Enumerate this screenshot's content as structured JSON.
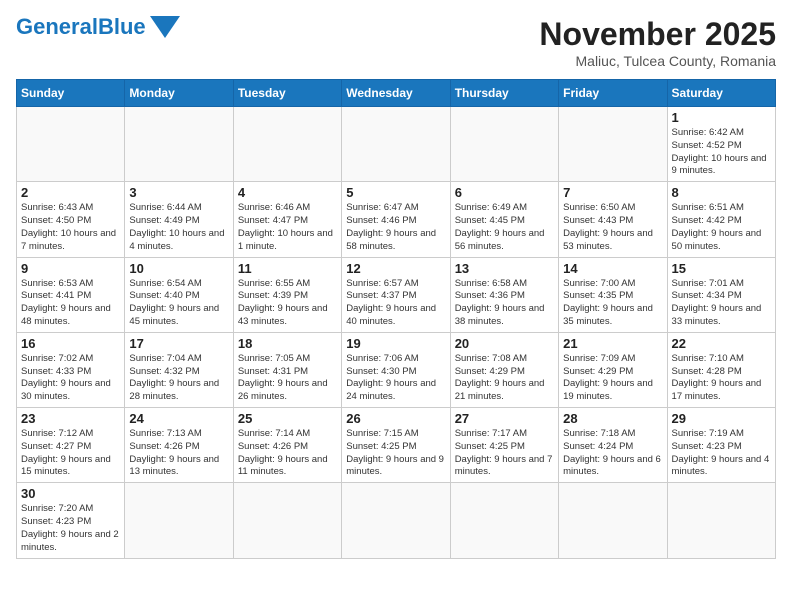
{
  "header": {
    "logo_general": "General",
    "logo_blue": "Blue",
    "month_title": "November 2025",
    "subtitle": "Maliuc, Tulcea County, Romania"
  },
  "days_of_week": [
    "Sunday",
    "Monday",
    "Tuesday",
    "Wednesday",
    "Thursday",
    "Friday",
    "Saturday"
  ],
  "weeks": [
    [
      {
        "day": "",
        "info": ""
      },
      {
        "day": "",
        "info": ""
      },
      {
        "day": "",
        "info": ""
      },
      {
        "day": "",
        "info": ""
      },
      {
        "day": "",
        "info": ""
      },
      {
        "day": "",
        "info": ""
      },
      {
        "day": "1",
        "info": "Sunrise: 6:42 AM\nSunset: 4:52 PM\nDaylight: 10 hours and 9 minutes."
      }
    ],
    [
      {
        "day": "2",
        "info": "Sunrise: 6:43 AM\nSunset: 4:50 PM\nDaylight: 10 hours and 7 minutes."
      },
      {
        "day": "3",
        "info": "Sunrise: 6:44 AM\nSunset: 4:49 PM\nDaylight: 10 hours and 4 minutes."
      },
      {
        "day": "4",
        "info": "Sunrise: 6:46 AM\nSunset: 4:47 PM\nDaylight: 10 hours and 1 minute."
      },
      {
        "day": "5",
        "info": "Sunrise: 6:47 AM\nSunset: 4:46 PM\nDaylight: 9 hours and 58 minutes."
      },
      {
        "day": "6",
        "info": "Sunrise: 6:49 AM\nSunset: 4:45 PM\nDaylight: 9 hours and 56 minutes."
      },
      {
        "day": "7",
        "info": "Sunrise: 6:50 AM\nSunset: 4:43 PM\nDaylight: 9 hours and 53 minutes."
      },
      {
        "day": "8",
        "info": "Sunrise: 6:51 AM\nSunset: 4:42 PM\nDaylight: 9 hours and 50 minutes."
      }
    ],
    [
      {
        "day": "9",
        "info": "Sunrise: 6:53 AM\nSunset: 4:41 PM\nDaylight: 9 hours and 48 minutes."
      },
      {
        "day": "10",
        "info": "Sunrise: 6:54 AM\nSunset: 4:40 PM\nDaylight: 9 hours and 45 minutes."
      },
      {
        "day": "11",
        "info": "Sunrise: 6:55 AM\nSunset: 4:39 PM\nDaylight: 9 hours and 43 minutes."
      },
      {
        "day": "12",
        "info": "Sunrise: 6:57 AM\nSunset: 4:37 PM\nDaylight: 9 hours and 40 minutes."
      },
      {
        "day": "13",
        "info": "Sunrise: 6:58 AM\nSunset: 4:36 PM\nDaylight: 9 hours and 38 minutes."
      },
      {
        "day": "14",
        "info": "Sunrise: 7:00 AM\nSunset: 4:35 PM\nDaylight: 9 hours and 35 minutes."
      },
      {
        "day": "15",
        "info": "Sunrise: 7:01 AM\nSunset: 4:34 PM\nDaylight: 9 hours and 33 minutes."
      }
    ],
    [
      {
        "day": "16",
        "info": "Sunrise: 7:02 AM\nSunset: 4:33 PM\nDaylight: 9 hours and 30 minutes."
      },
      {
        "day": "17",
        "info": "Sunrise: 7:04 AM\nSunset: 4:32 PM\nDaylight: 9 hours and 28 minutes."
      },
      {
        "day": "18",
        "info": "Sunrise: 7:05 AM\nSunset: 4:31 PM\nDaylight: 9 hours and 26 minutes."
      },
      {
        "day": "19",
        "info": "Sunrise: 7:06 AM\nSunset: 4:30 PM\nDaylight: 9 hours and 24 minutes."
      },
      {
        "day": "20",
        "info": "Sunrise: 7:08 AM\nSunset: 4:29 PM\nDaylight: 9 hours and 21 minutes."
      },
      {
        "day": "21",
        "info": "Sunrise: 7:09 AM\nSunset: 4:29 PM\nDaylight: 9 hours and 19 minutes."
      },
      {
        "day": "22",
        "info": "Sunrise: 7:10 AM\nSunset: 4:28 PM\nDaylight: 9 hours and 17 minutes."
      }
    ],
    [
      {
        "day": "23",
        "info": "Sunrise: 7:12 AM\nSunset: 4:27 PM\nDaylight: 9 hours and 15 minutes."
      },
      {
        "day": "24",
        "info": "Sunrise: 7:13 AM\nSunset: 4:26 PM\nDaylight: 9 hours and 13 minutes."
      },
      {
        "day": "25",
        "info": "Sunrise: 7:14 AM\nSunset: 4:26 PM\nDaylight: 9 hours and 11 minutes."
      },
      {
        "day": "26",
        "info": "Sunrise: 7:15 AM\nSunset: 4:25 PM\nDaylight: 9 hours and 9 minutes."
      },
      {
        "day": "27",
        "info": "Sunrise: 7:17 AM\nSunset: 4:25 PM\nDaylight: 9 hours and 7 minutes."
      },
      {
        "day": "28",
        "info": "Sunrise: 7:18 AM\nSunset: 4:24 PM\nDaylight: 9 hours and 6 minutes."
      },
      {
        "day": "29",
        "info": "Sunrise: 7:19 AM\nSunset: 4:23 PM\nDaylight: 9 hours and 4 minutes."
      }
    ],
    [
      {
        "day": "30",
        "info": "Sunrise: 7:20 AM\nSunset: 4:23 PM\nDaylight: 9 hours and 2 minutes."
      },
      {
        "day": "",
        "info": ""
      },
      {
        "day": "",
        "info": ""
      },
      {
        "day": "",
        "info": ""
      },
      {
        "day": "",
        "info": ""
      },
      {
        "day": "",
        "info": ""
      },
      {
        "day": "",
        "info": ""
      }
    ]
  ]
}
